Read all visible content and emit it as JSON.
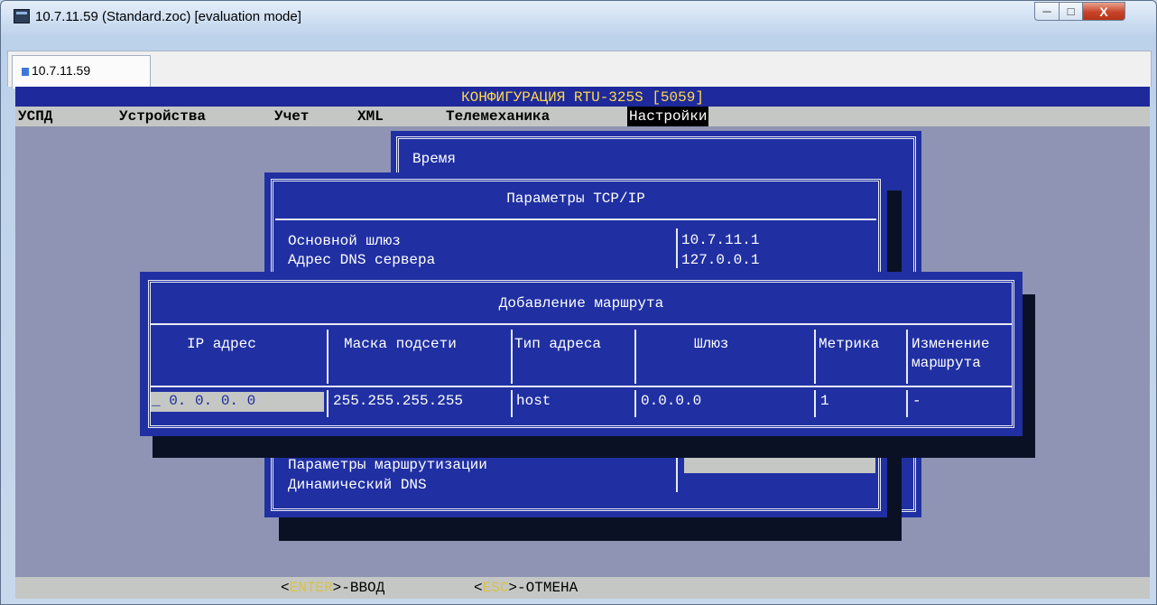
{
  "window": {
    "title": "10.7.11.59 (Standard.zoc) [evaluation mode]",
    "tab_label": "10.7.11.59",
    "close_label": "X",
    "icons": [
      "app-icon",
      "minimize-icon",
      "maximize-icon",
      "close-icon",
      "terminal-tab-icon"
    ]
  },
  "terminal": {
    "header": "КОНФИГУРАЦИЯ RTU-325S [5059]",
    "menu": [
      "УСПД",
      "Устройства",
      "Учет",
      "XML",
      "Телемеханика",
      "Настройки"
    ],
    "menu_selected": "Настройки",
    "footer": {
      "enter_key": "ENTER",
      "enter_text": "-ВВОД",
      "esc_key": "ESC",
      "esc_text": "-ОТМЕНА"
    }
  },
  "settings_menu": {
    "first_item": "Время"
  },
  "tcp_dialog": {
    "title": "Параметры TCP/IP",
    "gateway_label": "Основной шлюз",
    "gateway_value": "10.7.11.1",
    "dns_label": "Адрес DNS сервера",
    "dns_value": "127.0.0.1",
    "routing_label": "Параметры маршрутизации",
    "ddns_label": "Динамический DNS"
  },
  "route_dialog": {
    "title": "Добавление маршрута",
    "columns": [
      "IP адрес",
      "Маска подсети",
      "Тип адреса",
      "Шлюз",
      "Метрика",
      "Изменение",
      "маршрута"
    ],
    "row": {
      "ip": "_ 0.  0.  0.  0",
      "mask": "255.255.255.255",
      "type": "host",
      "gateway": "0.0.0.0",
      "metric": "1",
      "change": "-"
    }
  },
  "colors": {
    "terminal_bg": "#8f94b4",
    "dialog_bg": "#2030a2",
    "header_text": "#ffd94a",
    "menu_bar": "#c4c7c4"
  }
}
